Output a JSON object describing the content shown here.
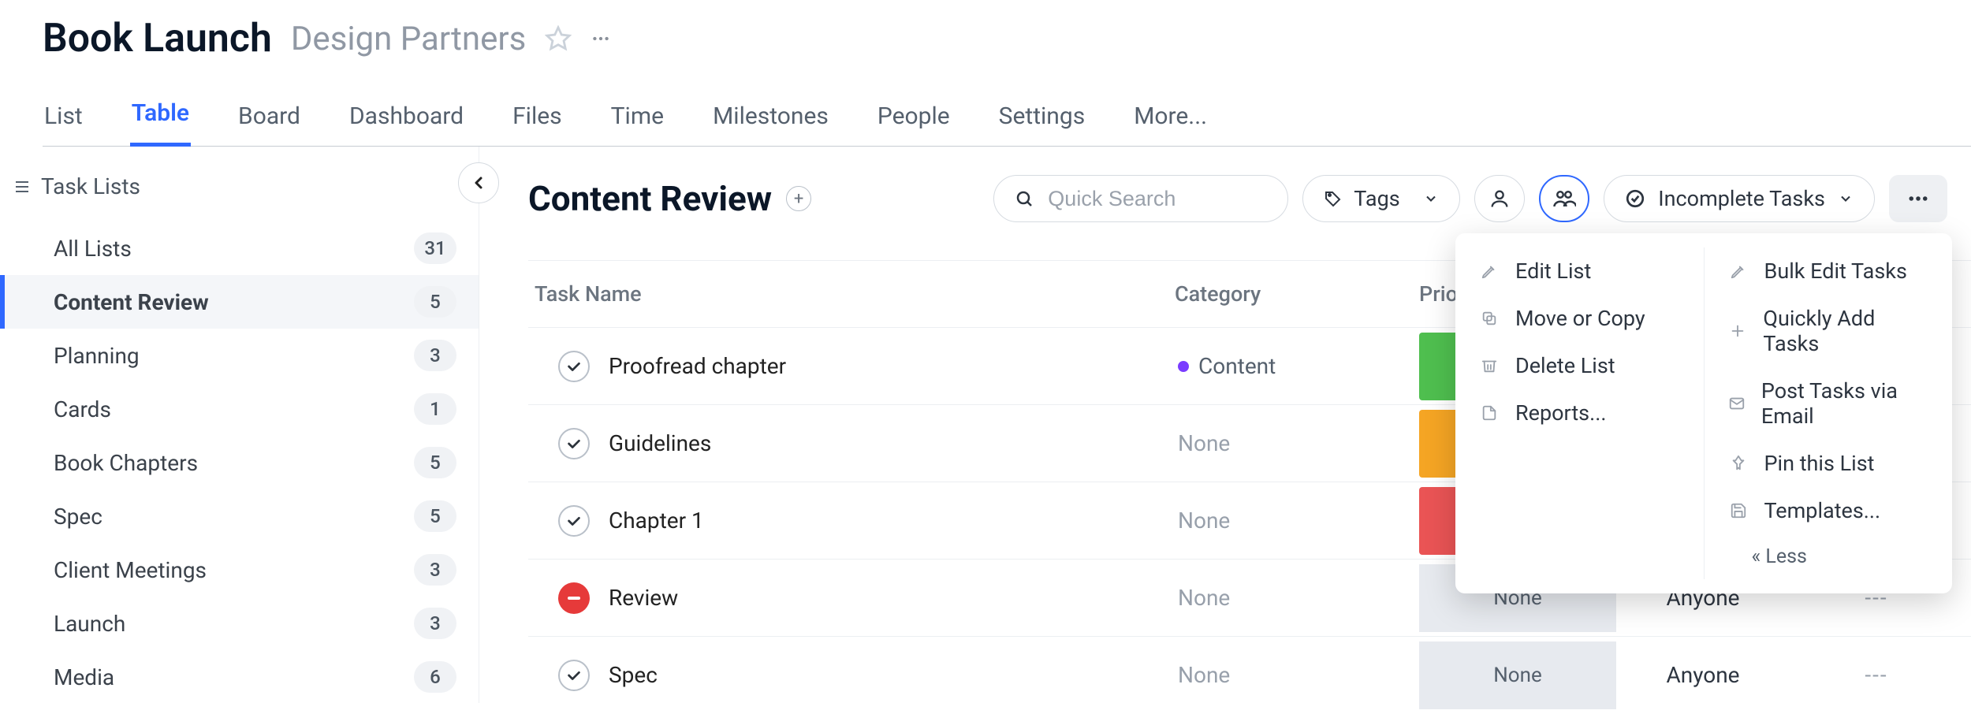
{
  "header": {
    "title": "Book Launch",
    "subtitle": "Design Partners"
  },
  "tabs": {
    "items": [
      "List",
      "Table",
      "Board",
      "Dashboard",
      "Files",
      "Time",
      "Milestones",
      "People",
      "Settings",
      "More..."
    ],
    "active_index": 1
  },
  "sidebar": {
    "title": "Task Lists",
    "items": [
      {
        "label": "All Lists",
        "count": "31"
      },
      {
        "label": "Content Review",
        "count": "5"
      },
      {
        "label": "Planning",
        "count": "3"
      },
      {
        "label": "Cards",
        "count": "1"
      },
      {
        "label": "Book Chapters",
        "count": "5"
      },
      {
        "label": "Spec",
        "count": "5"
      },
      {
        "label": "Client Meetings",
        "count": "3"
      },
      {
        "label": "Launch",
        "count": "3"
      },
      {
        "label": "Media",
        "count": "6"
      }
    ],
    "active_index": 1
  },
  "main": {
    "section_title": "Content Review",
    "search_placeholder": "Quick Search",
    "tags_label": "Tags",
    "filter_label": "Incomplete Tasks",
    "columns": {
      "name": "Task Name",
      "category": "Category",
      "priority": "Prio",
      "assignee": "",
      "due": ""
    },
    "rows": [
      {
        "name": "Proofread chapter",
        "status": "open",
        "category": {
          "text": "Content",
          "color": "#7a3cff"
        },
        "priority": "green",
        "assignee": "",
        "due": ""
      },
      {
        "name": "Guidelines",
        "status": "open",
        "category": {
          "text": "None",
          "color": ""
        },
        "priority": "orange",
        "assignee": "",
        "due": ""
      },
      {
        "name": "Chapter 1",
        "status": "open",
        "category": {
          "text": "None",
          "color": ""
        },
        "priority": "red",
        "assignee": "",
        "due": ""
      },
      {
        "name": "Review",
        "status": "blocked",
        "category": {
          "text": "None",
          "color": ""
        },
        "priority": "none",
        "priority_text": "None",
        "assignee": "Anyone",
        "due": "---"
      },
      {
        "name": "Spec",
        "status": "open",
        "category": {
          "text": "None",
          "color": ""
        },
        "priority": "none",
        "priority_text": "None",
        "assignee": "Anyone",
        "due": "---"
      }
    ]
  },
  "dropdown": {
    "left": [
      {
        "icon": "pencil",
        "label": "Edit List"
      },
      {
        "icon": "copy",
        "label": "Move or Copy"
      },
      {
        "icon": "trash",
        "label": "Delete List"
      },
      {
        "icon": "doc",
        "label": "Reports..."
      }
    ],
    "right": [
      {
        "icon": "pencil",
        "label": "Bulk Edit Tasks"
      },
      {
        "icon": "plus",
        "label": "Quickly Add Tasks"
      },
      {
        "icon": "mail",
        "label": "Post Tasks via Email"
      },
      {
        "icon": "pin",
        "label": "Pin this List"
      },
      {
        "icon": "save",
        "label": "Templates..."
      }
    ],
    "less_label": "« Less"
  }
}
